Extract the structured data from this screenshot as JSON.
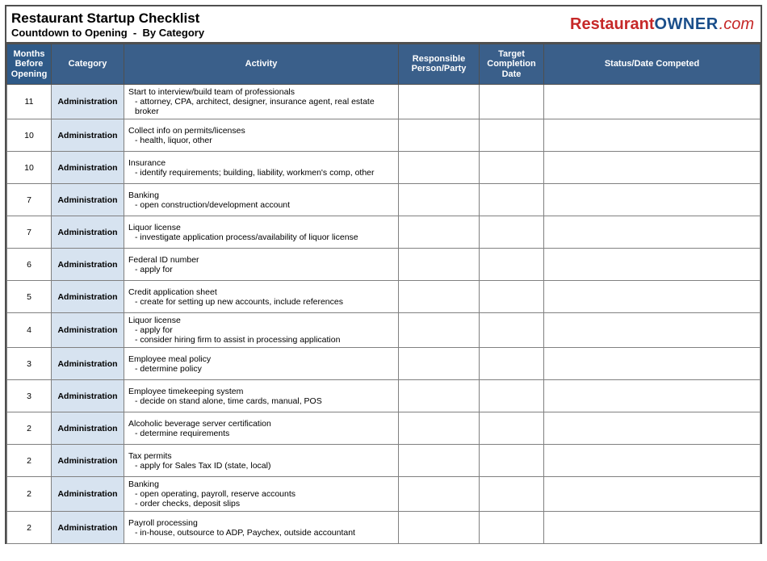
{
  "header": {
    "title": "Restaurant Startup Checklist",
    "subtitle_left": "Countdown to Opening",
    "subtitle_sep": "-",
    "subtitle_right": "By Category",
    "logo_red": "Restaurant",
    "logo_blue": "OWNER",
    "logo_com": ".com"
  },
  "columns": {
    "months": "Months Before Opening",
    "category": "Category",
    "activity": "Activity",
    "responsible": "Responsible Person/Party",
    "target": "Target Completion Date",
    "status": "Status/Date Competed"
  },
  "rows": [
    {
      "months": "11",
      "category": "Administration",
      "activity_title": "Start to interview/build team of professionals",
      "activity_details": [
        "- attorney, CPA, architect, designer, insurance agent, real estate broker"
      ]
    },
    {
      "months": "10",
      "category": "Administration",
      "activity_title": "Collect info on permits/licenses",
      "activity_details": [
        "- health, liquor, other"
      ]
    },
    {
      "months": "10",
      "category": "Administration",
      "activity_title": "Insurance",
      "activity_details": [
        "- identify requirements; building, liability, workmen's comp, other"
      ]
    },
    {
      "months": "7",
      "category": "Administration",
      "activity_title": "Banking",
      "activity_details": [
        "- open construction/development account"
      ]
    },
    {
      "months": "7",
      "category": "Administration",
      "activity_title": "Liquor license",
      "activity_details": [
        "- investigate application process/availability of liquor license"
      ]
    },
    {
      "months": "6",
      "category": "Administration",
      "activity_title": "Federal ID number",
      "activity_details": [
        "- apply for"
      ]
    },
    {
      "months": "5",
      "category": "Administration",
      "activity_title": "Credit application sheet",
      "activity_details": [
        "- create for setting up new accounts, include references"
      ]
    },
    {
      "months": "4",
      "category": "Administration",
      "activity_title": "Liquor license",
      "activity_details": [
        "- apply for",
        "- consider hiring firm to assist in processing application"
      ]
    },
    {
      "months": "3",
      "category": "Administration",
      "activity_title": "Employee meal policy",
      "activity_details": [
        "- determine policy"
      ]
    },
    {
      "months": "3",
      "category": "Administration",
      "activity_title": "Employee timekeeping system",
      "activity_details": [
        "- decide on stand alone, time cards, manual, POS"
      ]
    },
    {
      "months": "2",
      "category": "Administration",
      "activity_title": "Alcoholic beverage server certification",
      "activity_details": [
        "- determine requirements"
      ]
    },
    {
      "months": "2",
      "category": "Administration",
      "activity_title": "Tax permits",
      "activity_details": [
        "- apply for Sales Tax ID (state, local)"
      ]
    },
    {
      "months": "2",
      "category": "Administration",
      "activity_title": "Banking",
      "activity_details": [
        "- open operating, payroll, reserve accounts",
        "- order checks, deposit slips"
      ]
    },
    {
      "months": "2",
      "category": "Administration",
      "activity_title": "Payroll processing",
      "activity_details": [
        "- in-house, outsource to ADP, Paychex, outside accountant"
      ]
    }
  ]
}
